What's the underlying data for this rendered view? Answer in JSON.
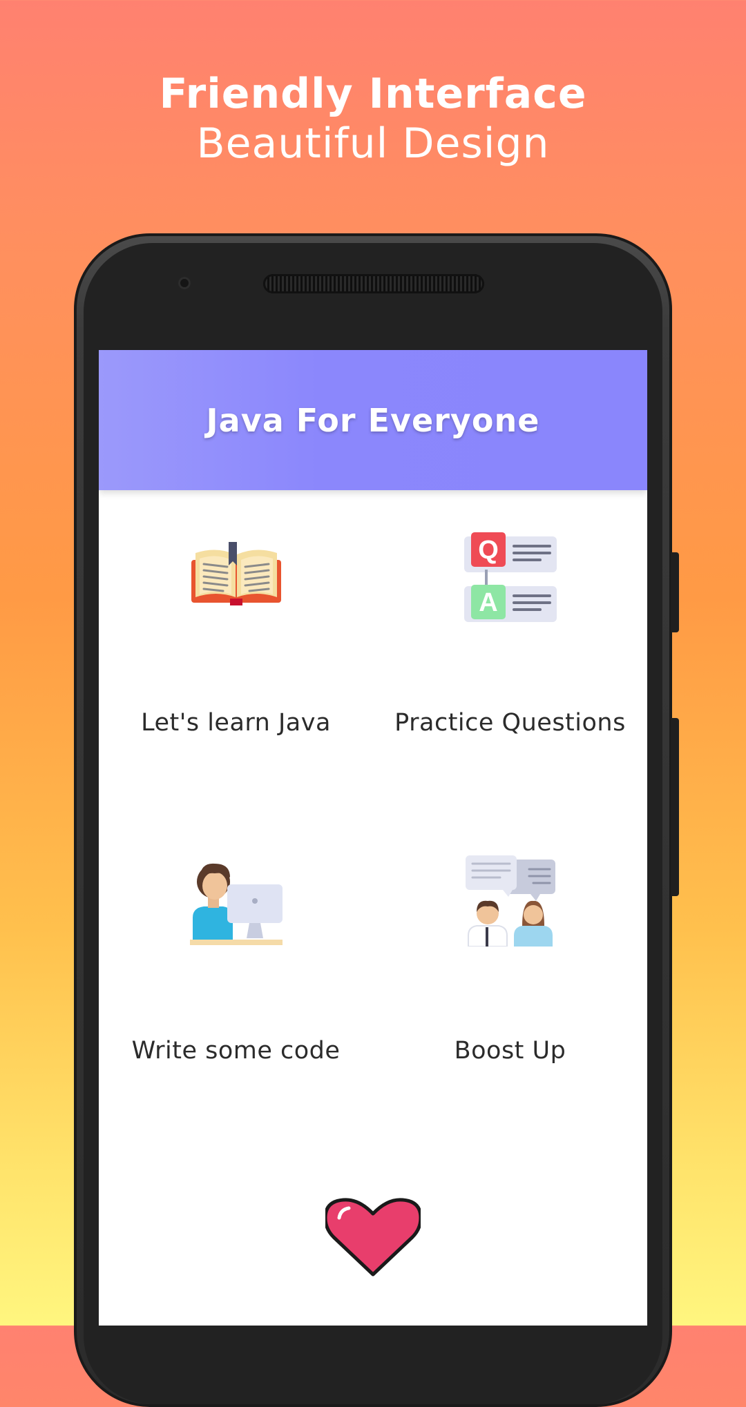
{
  "promo": {
    "line1": "Friendly Interface",
    "line2": "Beautiful Design"
  },
  "app": {
    "title": "Java For Everyone"
  },
  "tiles": [
    {
      "label": "Let's learn Java",
      "icon": "open-book-icon"
    },
    {
      "label": "Practice Questions",
      "icon": "qa-icon"
    },
    {
      "label": "Write some code",
      "icon": "coder-at-computer-icon"
    },
    {
      "label": "Boost Up",
      "icon": "people-chat-icon"
    }
  ],
  "footer": {
    "icon": "heart-icon"
  },
  "colors": {
    "appbar": "#8a86fc",
    "heart": "#e83e6c",
    "background_top": "#ff8170",
    "background_bottom": "#fff67f"
  }
}
